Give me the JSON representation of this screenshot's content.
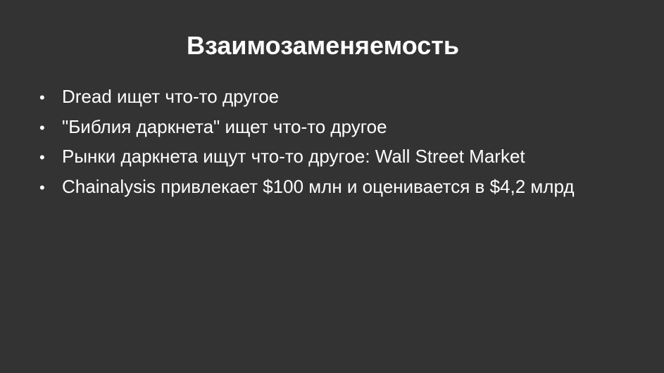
{
  "slide": {
    "title": "Взаимозаменяемость",
    "bullet_glyph": "•",
    "bullets": [
      {
        "text": "Dread ищет что-то другое"
      },
      {
        "text": "\"Библия даркнета\" ищет что-то другое"
      },
      {
        "text": "Рынки даркнета ищут что-то другое: Wall Street Market"
      },
      {
        "text": "Chainalysis привлекает $100 млн и оценивается в $4,2 млрд"
      }
    ]
  },
  "colors": {
    "background": "#333333",
    "text": "#ffffff"
  }
}
